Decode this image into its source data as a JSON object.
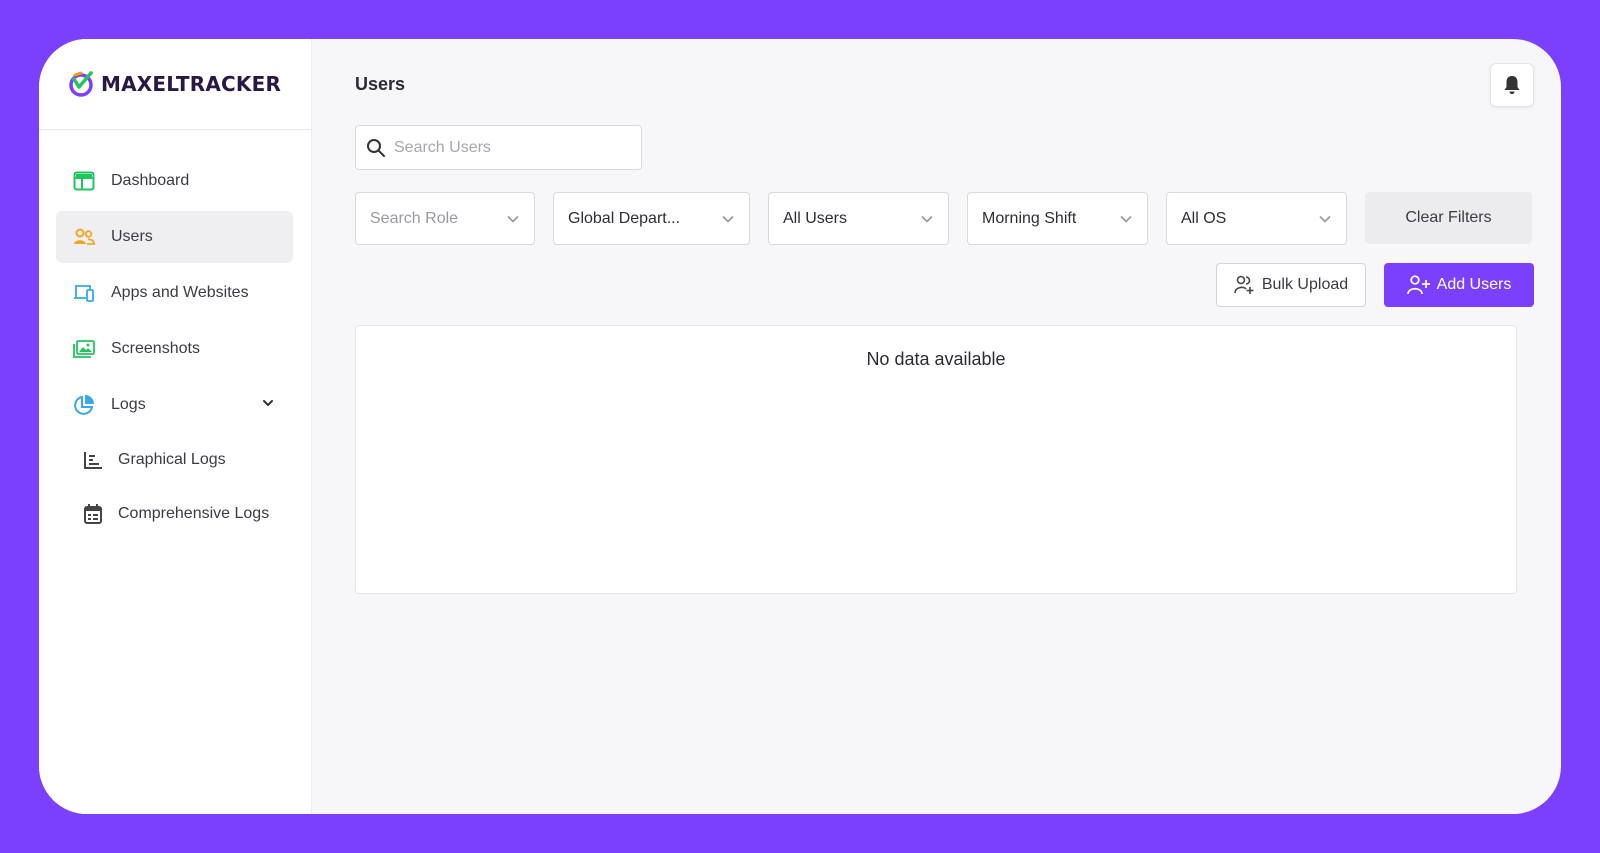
{
  "brand": {
    "name": "MAXELTRACKER",
    "logo_icon": "check-shield-logo",
    "accent": "#7b3ffe"
  },
  "sidebar": {
    "items": [
      {
        "label": "Dashboard",
        "icon": "dashboard-icon",
        "active": false
      },
      {
        "label": "Users",
        "icon": "users-icon",
        "active": true
      },
      {
        "label": "Apps and Websites",
        "icon": "devices-icon",
        "active": false
      },
      {
        "label": "Screenshots",
        "icon": "image-icon",
        "active": false
      },
      {
        "label": "Logs",
        "icon": "pie-chart-icon",
        "active": false,
        "expanded": true
      }
    ],
    "subitems": [
      {
        "label": "Graphical Logs",
        "icon": "bar-chart-icon"
      },
      {
        "label": "Comprehensive Logs",
        "icon": "calendar-icon"
      }
    ]
  },
  "header": {
    "title": "Users",
    "notification_icon": "bell-icon"
  },
  "search": {
    "placeholder": "Search Users",
    "value": ""
  },
  "filters": {
    "role": {
      "placeholder": "Search Role"
    },
    "department": {
      "value": "Global Depart..."
    },
    "users": {
      "value": "All Users"
    },
    "shift": {
      "value": "Morning Shift"
    },
    "os": {
      "value": "All OS"
    },
    "clear_label": "Clear Filters"
  },
  "actions": {
    "bulk_upload_label": "Bulk Upload",
    "add_users_label": "Add Users"
  },
  "table": {
    "empty_text": "No data available"
  }
}
